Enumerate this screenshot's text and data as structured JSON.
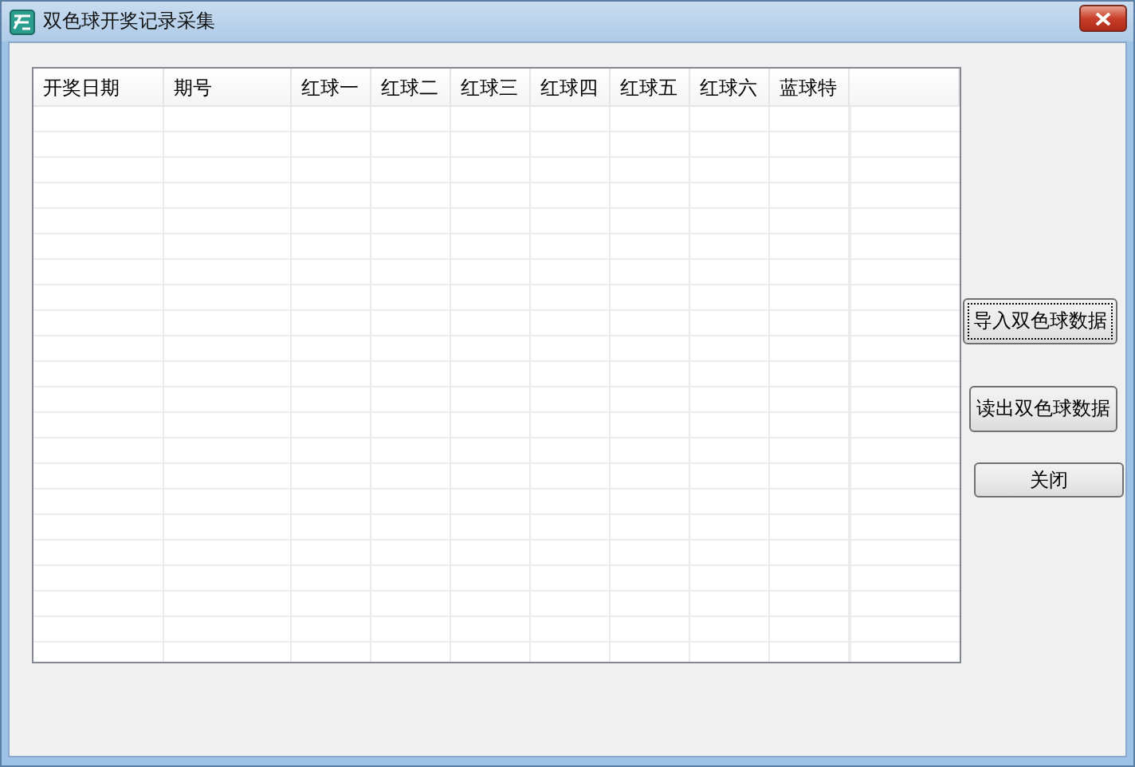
{
  "window": {
    "title": "双色球开奖记录采集"
  },
  "table": {
    "columns": [
      "开奖日期",
      "期号",
      "红球一",
      "红球二",
      "红球三",
      "红球四",
      "红球五",
      "红球六",
      "蓝球特"
    ]
  },
  "buttons": [
    {
      "label": "导入双色球数据",
      "focused": true
    },
    {
      "label": "读出双色球数据",
      "focused": false
    },
    {
      "label": "关闭",
      "focused": false
    }
  ]
}
